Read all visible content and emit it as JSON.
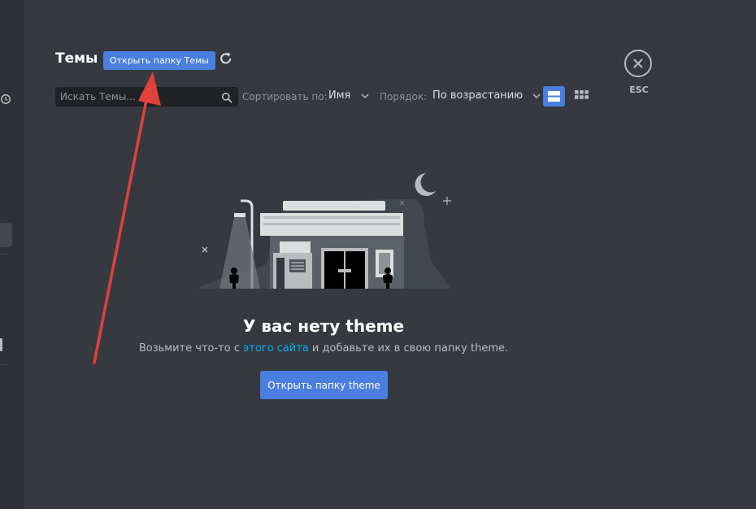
{
  "header": {
    "title": "Темы",
    "open_folder_label": "Открыть папку Темы",
    "close_label": "ESC"
  },
  "toolbar": {
    "search_placeholder": "Искать Темы...",
    "sort_by_label": "Сортировать по:",
    "sort_by_value": "Имя",
    "order_label": "Порядок:",
    "order_value": "По возрастанию",
    "view_modes": [
      "list",
      "grid"
    ],
    "active_view": "list"
  },
  "empty_state": {
    "title": "У вас нету theme",
    "desc_before": "Возьмите что-то с ",
    "desc_link": "этого сайта",
    "desc_after": " и добавьте их в свою папку theme.",
    "button_label": "Открыть папку theme"
  },
  "colors": {
    "background": "#36393f",
    "sidebar": "#2f3136",
    "accent": "#4a7fe0",
    "link": "#00b0f4",
    "annotation_arrow": "#e0413a"
  },
  "icons": {
    "reload": "reload-icon",
    "search": "search-icon",
    "close": "close-icon",
    "history": "history-icon"
  }
}
